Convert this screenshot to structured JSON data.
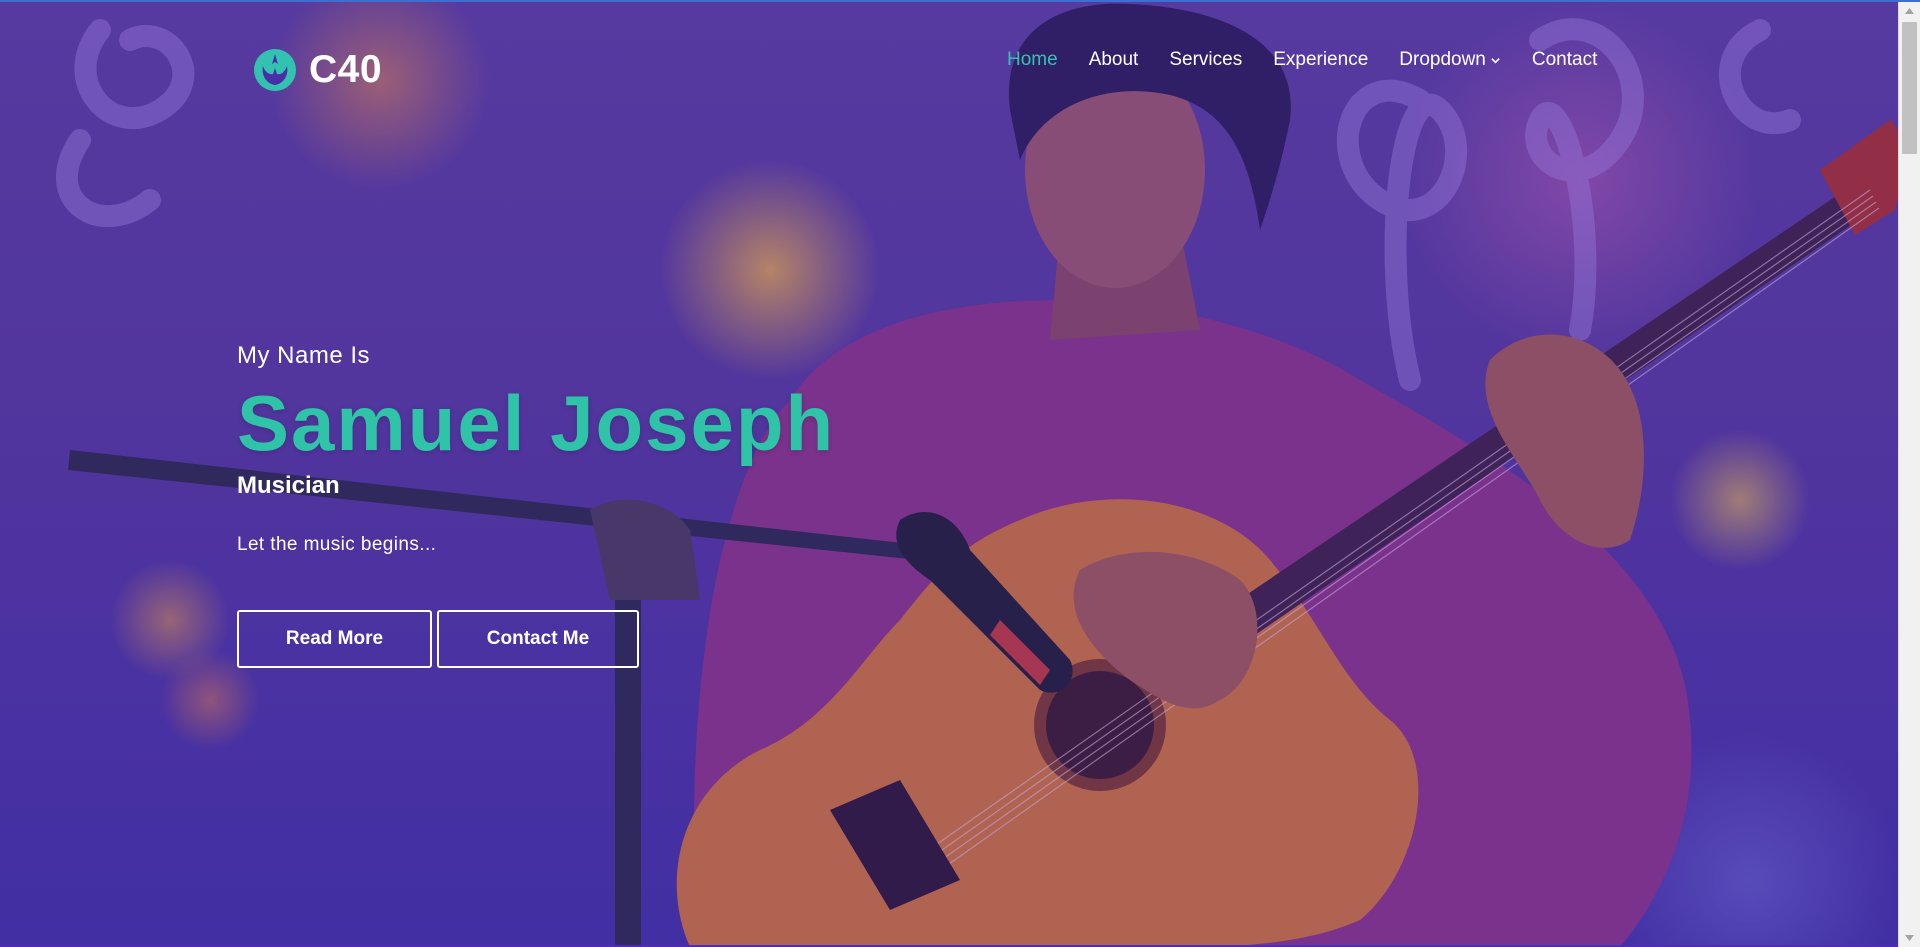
{
  "brand": {
    "logo_icon": "rebel-alliance-icon",
    "name": "C40",
    "accent_color": "#34c2b0"
  },
  "nav": {
    "items": [
      {
        "label": "Home",
        "active": true
      },
      {
        "label": "About",
        "active": false
      },
      {
        "label": "Services",
        "active": false
      },
      {
        "label": "Experience",
        "active": false
      },
      {
        "label": "Dropdown",
        "active": false,
        "has_submenu": true,
        "icon": "chevron-down-icon"
      },
      {
        "label": "Contact",
        "active": false
      }
    ]
  },
  "hero": {
    "intro": "My Name Is",
    "name": "Samuel Joseph",
    "role": "Musician",
    "tagline": "Let the music begins...",
    "buttons": {
      "read_more": "Read More",
      "contact_me": "Contact Me"
    },
    "background_subject": "musician playing classical guitar with microphone, purple music-note backdrop"
  },
  "colors": {
    "overlay": "#4a2ea8",
    "name_text": "#2fc3a8",
    "active_nav": "#34c2b0",
    "button_border": "#ffffff"
  }
}
